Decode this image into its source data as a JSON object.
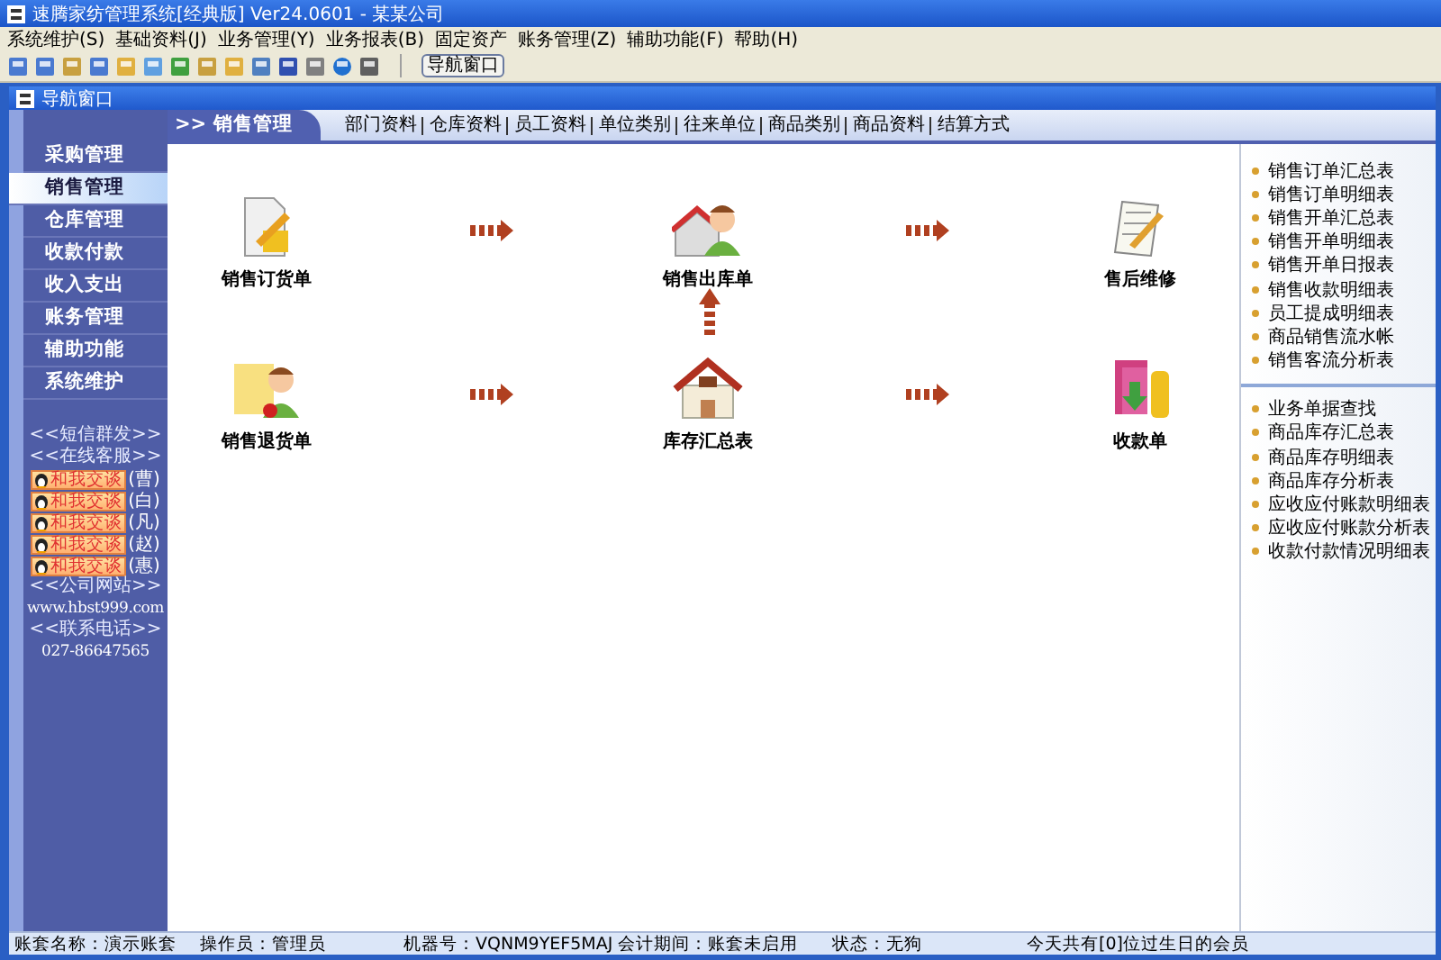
{
  "window": {
    "title": "速腾家纺管理系统[经典版] Ver24.0601  -  某某公司"
  },
  "menu": [
    "系统维护(S)",
    "基础资料(J)",
    "业务管理(Y)",
    "业务报表(B)",
    "固定资产",
    "账务管理(Z)",
    "辅助功能(F)",
    "帮助(H)"
  ],
  "toolbar": {
    "button": "导航窗口"
  },
  "nav_window": {
    "title": "导航窗口"
  },
  "sidebar": {
    "items": [
      {
        "label": "采购管理",
        "selected": false
      },
      {
        "label": "销售管理",
        "selected": true
      },
      {
        "label": "仓库管理",
        "selected": false
      },
      {
        "label": "收款付款",
        "selected": false
      },
      {
        "label": "收入支出",
        "selected": false
      },
      {
        "label": "账务管理",
        "selected": false
      },
      {
        "label": "辅助功能",
        "selected": false
      },
      {
        "label": "系统维护",
        "selected": false
      }
    ],
    "links": [
      "<<短信群发>>",
      "<<在线客服>>"
    ],
    "chat": [
      {
        "button": "和我交谈",
        "name": "(曹)"
      },
      {
        "button": "和我交谈",
        "name": "(白)"
      },
      {
        "button": "和我交谈",
        "name": "(凡)"
      },
      {
        "button": "和我交谈",
        "name": "(赵)"
      },
      {
        "button": "和我交谈",
        "name": "(惠)"
      }
    ],
    "website_label": "<<公司网站>>",
    "website": "www.hbst999.com",
    "phone_label": "<<联系电话>>",
    "phone": "027-86647565"
  },
  "section": {
    "title": ">> 销售管理",
    "links": [
      "部门资料",
      "仓库资料",
      "员工资料",
      "单位类别",
      "往来单位",
      "商品类别",
      "商品资料",
      "结算方式"
    ]
  },
  "flow": {
    "nodes": [
      {
        "kind": "order",
        "label": "销售订货单"
      },
      {
        "kind": "outbound",
        "label": "销售出库单"
      },
      {
        "kind": "repair",
        "label": "售后维修"
      },
      {
        "kind": "return",
        "label": "销售退货单"
      },
      {
        "kind": "stock",
        "label": "库存汇总表"
      },
      {
        "kind": "receipt",
        "label": "收款单"
      }
    ]
  },
  "reports": [
    [
      "销售订单汇总表",
      "销售订单明细表",
      "销售开单汇总表",
      "销售开单明细表",
      "销售开单日报表",
      "销售收款明细表",
      "员工提成明细表",
      "商品销售流水帐",
      "销售客流分析表"
    ],
    [
      "业务单据查找",
      "商品库存汇总表",
      "商品库存明细表",
      "商品库存分析表",
      "应收应付账款明细表",
      "应收应付账款分析表",
      "收款付款情况明细表"
    ]
  ],
  "status_bar": [
    "账套名称：演示账套",
    "操作员：管理员",
    "机器号：VQNM9YEF5MAJ 会计期间：账套未启用",
    "状态：无狗",
    "今天共有[0]位过生日的会员"
  ]
}
